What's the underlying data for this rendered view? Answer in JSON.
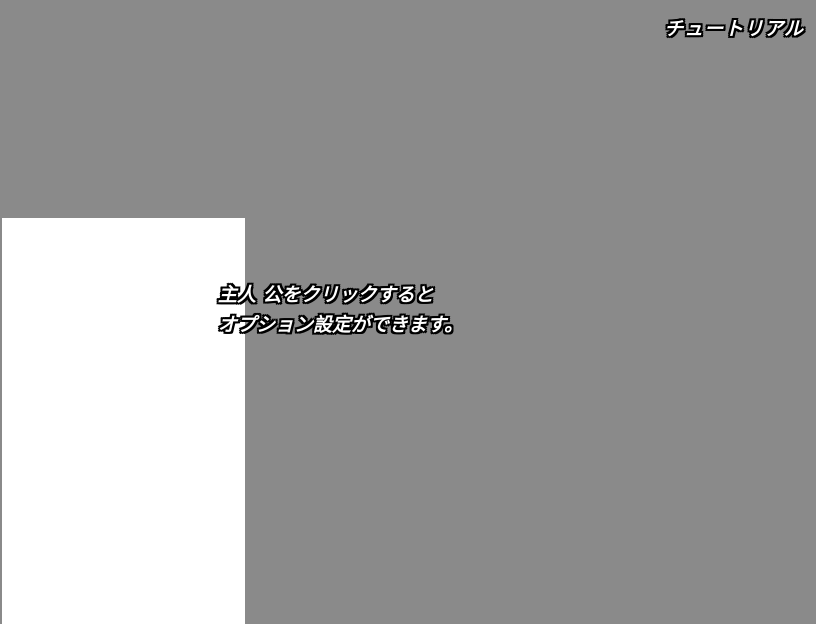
{
  "tutorial": {
    "title": "チュートリアル",
    "hint_lines": [
      "主人 公をクリックすると",
      "オプション設定ができます。"
    ]
  },
  "colors": {
    "background": "#8a8a8a",
    "highlight": "#ffffff",
    "text": "#ffffff",
    "text_outline": "#000000"
  }
}
